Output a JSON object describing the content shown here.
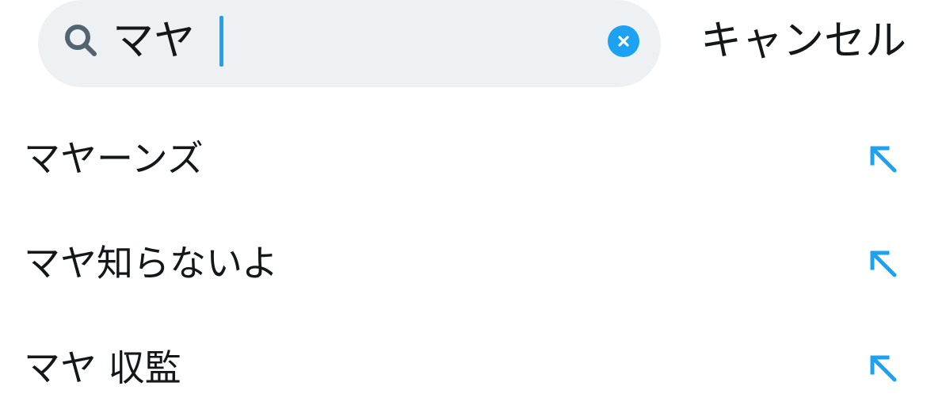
{
  "search": {
    "query": "マヤ",
    "clear_icon": "close-circle-icon",
    "search_icon": "search-icon"
  },
  "cancel_label": "キャンセル",
  "suggestions": [
    {
      "label": "マヤーンズ",
      "icon": "fill-query-arrow-icon"
    },
    {
      "label": "マヤ知らないよ",
      "icon": "fill-query-arrow-icon"
    },
    {
      "label": "マヤ 収監",
      "icon": "fill-query-arrow-icon"
    }
  ],
  "colors": {
    "accent": "#1da1f2",
    "search_bg": "#eef1f3",
    "text": "#14171a",
    "icon_gray": "#536471"
  }
}
